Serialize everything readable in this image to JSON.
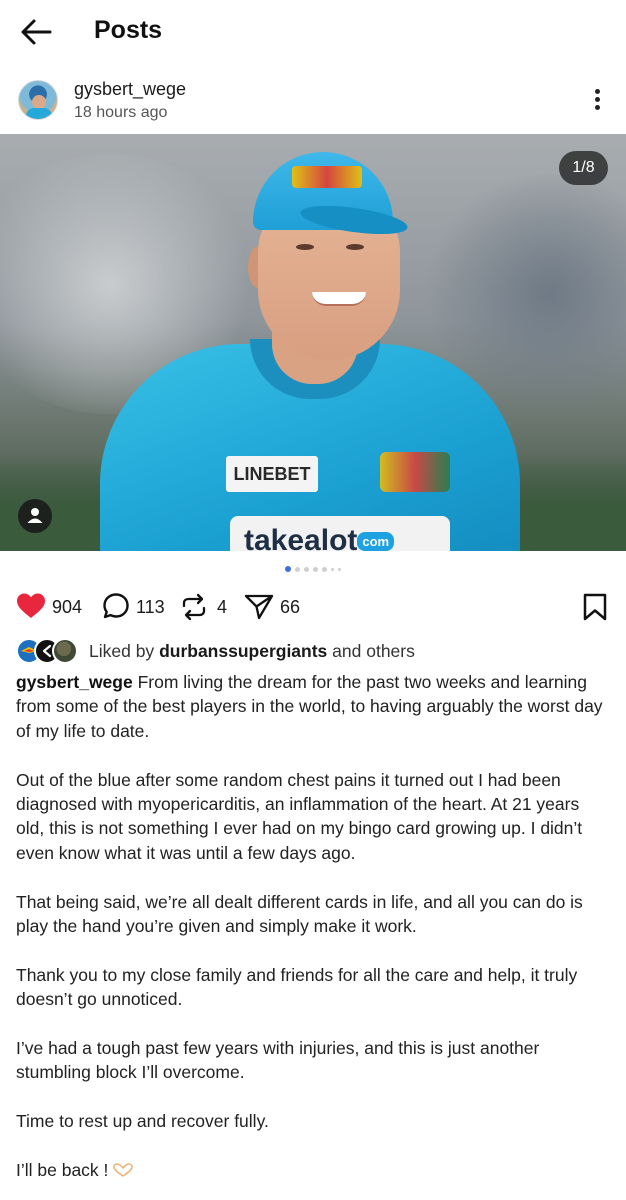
{
  "header": {
    "title": "Posts"
  },
  "post": {
    "author": "gysbert_wege",
    "time": "18 hours ago",
    "image_counter": "1/8",
    "sponsor_left": "LINEBET",
    "sponsor_main": "takealot",
    "sponsor_suffix": "com",
    "carousel": {
      "total_dots": 7,
      "active_index": 0
    }
  },
  "actions": {
    "likes": "904",
    "comments": "113",
    "reposts": "4",
    "shares": "66"
  },
  "liked_by": {
    "prefix": "Liked by",
    "account": "durbanssupergiants",
    "suffix": "and others"
  },
  "caption": {
    "username": "gysbert_wege",
    "p1": "From living the dream for the past two weeks and learning from some of the best players in the world, to having arguably the worst day of my life to date.",
    "p2": "Out of the blue after some random chest pains it turned out I had been diagnosed with myopericarditis, an inflammation of the heart. At 21 years old, this is not something I ever had on my bingo card growing up. I didn’t even know what it was until a few days ago.",
    "p3": "That being said, we’re all dealt different cards in life, and all you can do is play the hand you’re given and simply make it work.",
    "p4": "Thank you to my close family and friends for all the care and help, it truly doesn’t go unnoticed.",
    "p5": "I’ve had a tough past few years with injuries, and this is just another stumbling block I’ll overcome.",
    "p6": "Time to rest up and recover fully.",
    "p7": "I’ll be back !",
    "p7_emoji": "heart-hands-emoji"
  },
  "colors": {
    "like_red": "#e8263d",
    "accent_blue": "#3b6fe0"
  }
}
